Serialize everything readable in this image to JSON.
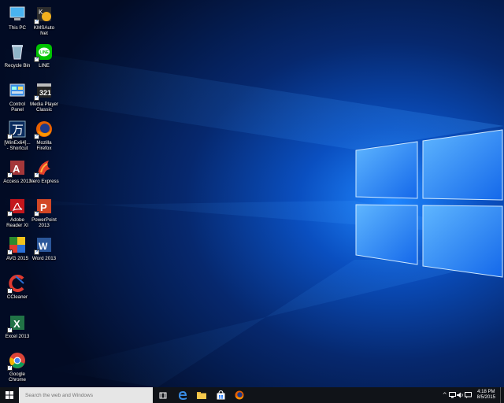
{
  "desktop": {
    "icons": [
      {
        "label": "This PC"
      },
      {
        "label": "KMSAuto\nNet"
      },
      {
        "label": "Recycle Bin"
      },
      {
        "label": "LINE"
      },
      {
        "label": "Control\nPanel"
      },
      {
        "label": "Media Player\nClassic"
      },
      {
        "label": "[WinEx64]...\n- Shortcut"
      },
      {
        "label": "Mozilla\nFirefox"
      },
      {
        "label": "Access 2013"
      },
      {
        "label": "Nero Express"
      },
      {
        "label": "Adobe\nReader XI"
      },
      {
        "label": "PowerPoint\n2013"
      },
      {
        "label": "AVG 2015"
      },
      {
        "label": "Word 2013"
      },
      {
        "label": "CCleaner"
      },
      {
        "label": "Excel 2013"
      },
      {
        "label": "Google\nChrome"
      }
    ]
  },
  "taskbar": {
    "search_placeholder": "Search the web and Windows",
    "clock": {
      "time": "4:18 PM",
      "date": "8/5/2015"
    }
  },
  "colors": {
    "accent": "#1e78ff",
    "taskbar": "#101318",
    "search": "#e6e6e6"
  }
}
